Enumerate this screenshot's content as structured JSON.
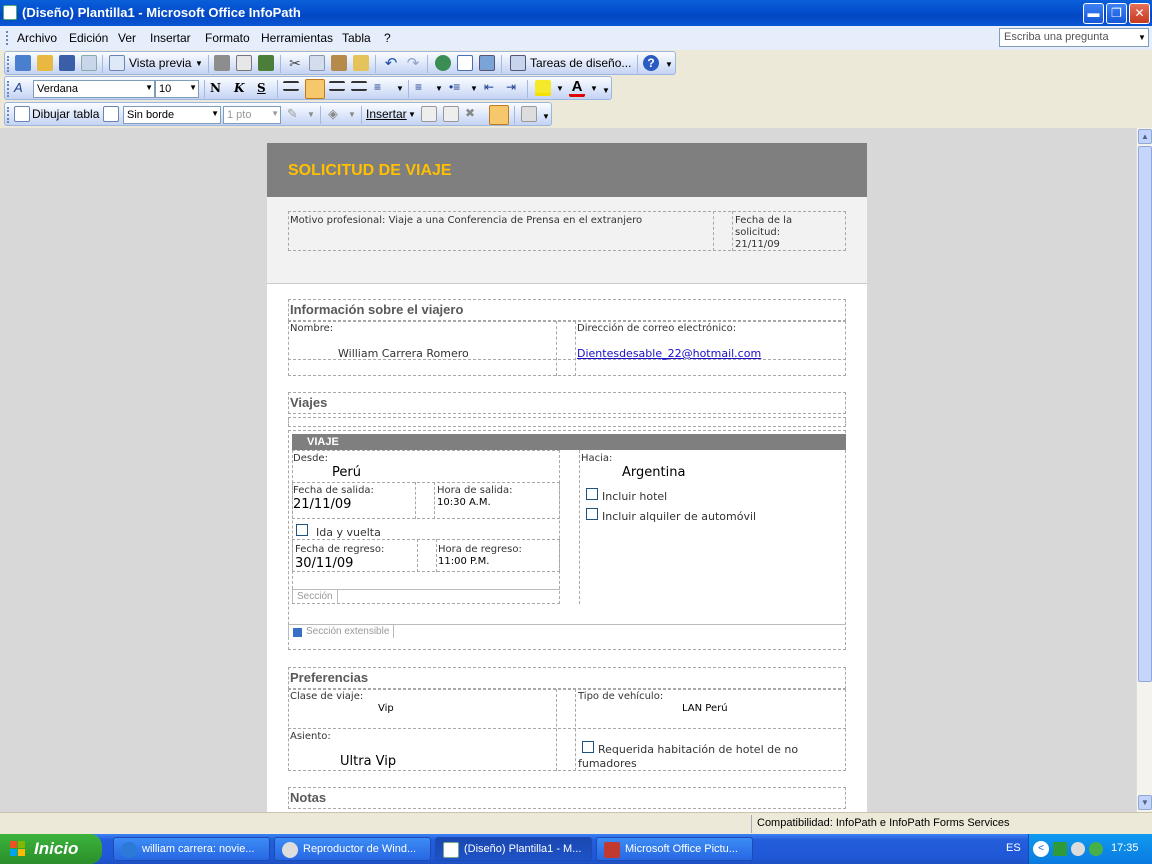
{
  "window": {
    "title": "(Diseño) Plantilla1 - Microsoft Office InfoPath"
  },
  "menu": {
    "items": [
      "Archivo",
      "Edición",
      "Ver",
      "Insertar",
      "Formato",
      "Herramientas",
      "Tabla",
      "?"
    ],
    "ask_placeholder": "Escriba una pregunta"
  },
  "toolbar1": {
    "preview_label": "Vista previa",
    "design_tasks_label": "Tareas de diseño..."
  },
  "toolbar2": {
    "font": "Verdana",
    "size": "10",
    "bold": "N",
    "italic": "K",
    "underline": "S"
  },
  "toolbar3": {
    "draw_table": "Dibujar tabla",
    "border": "Sin borde",
    "border_width": "1 pto",
    "insert": "Insertar"
  },
  "form": {
    "title": "SOLICITUD DE VIAJE",
    "motivo": "Motivo profesional: Viaje a una Conferencia de Prensa en el extranjero",
    "fecha_label": "Fecha de la solicitud:",
    "fecha_value": "21/11/09",
    "traveler": {
      "title": "Información sobre el viajero",
      "name_label": "Nombre:",
      "name_value": "William Carrera Romero",
      "email_label": "Dirección de correo electrónico:",
      "email_value": "Dientesdesable_22@hotmail.com"
    },
    "trips": {
      "title": "Viajes",
      "header": "VIAJE",
      "desde_label": "Desde:",
      "desde_value": "Perú",
      "hacia_label": "Hacia:",
      "hacia_value": "Argentina",
      "salida_fecha_label": "Fecha de salida:",
      "salida_fecha_value": "21/11/09",
      "salida_hora_label": "Hora de salida:",
      "salida_hora_value": "10:30 A.M.",
      "hotel_label": "Incluir hotel",
      "car_label": "Incluir alquiler de automóvil",
      "roundtrip_label": "Ida y vuelta",
      "regreso_fecha_label": "Fecha de regreso:",
      "regreso_fecha_value": "30/11/09",
      "regreso_hora_label": "Hora de regreso:",
      "regreso_hora_value": "11:00 P.M.",
      "section_tag": "Sección",
      "repeating_tag": "Sección extensible"
    },
    "prefs": {
      "title": "Preferencias",
      "clase_label": "Clase de viaje:",
      "clase_value": "Vip",
      "vehiculo_label": "Tipo de vehículo:",
      "vehiculo_value": "LAN Perú",
      "asiento_label": "Asiento:",
      "asiento_value": "Ultra Vip",
      "nosmoke_label": "Requerida habitación de hotel de no fumadores"
    },
    "notes": {
      "title": "Notas"
    }
  },
  "status": {
    "compat": "Compatibilidad: InfoPath e InfoPath Forms Services"
  },
  "taskbar": {
    "start": "Inicio",
    "tasks": [
      "william carrera: novie...",
      "Reproductor de Wind...",
      "(Diseño) Plantilla1 - M...",
      "Microsoft Office Pictu..."
    ],
    "lang": "ES",
    "clock": "17:35"
  }
}
